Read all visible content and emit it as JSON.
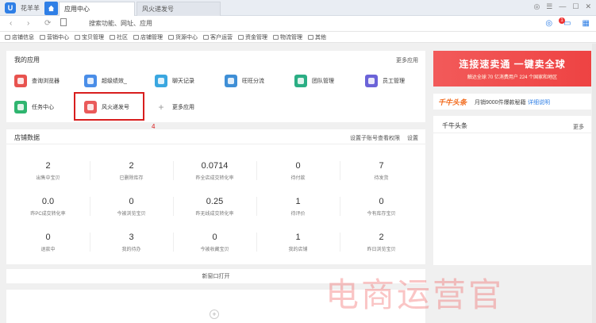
{
  "titlebar": {
    "app_name": "花羊羊",
    "logo_glyph": "U",
    "tabs": [
      {
        "label": "应用中心",
        "active": true
      },
      {
        "label": "风火递发号",
        "active": false
      }
    ],
    "controls": [
      "◎",
      "☰",
      "—",
      "☐",
      "✕"
    ]
  },
  "nav": {
    "back": "‹",
    "forward": "›",
    "refresh": "⟳",
    "address": "搜索功能、网址、应用",
    "badge_count": "1"
  },
  "bookmarks": [
    "店铺信息",
    "营销中心",
    "宝贝管理",
    "社区",
    "店铺管理",
    "货源中心",
    "客户运营",
    "资金管理",
    "物流管理",
    "其他"
  ],
  "my_apps": {
    "title": "我的应用",
    "more_link": "更多应用",
    "apps": [
      {
        "label": "查询浏览器",
        "color": "#e8534f"
      },
      {
        "label": "超级绩效_",
        "color": "#4a8ee8"
      },
      {
        "label": "聊天记录",
        "color": "#3aa7e0"
      },
      {
        "label": "旺旺分流",
        "color": "#3f8fd6"
      },
      {
        "label": "团队管理",
        "color": "#2bae84"
      },
      {
        "label": "员工管理",
        "color": "#6b63d8"
      },
      {
        "label": "任务中心",
        "color": "#2fb56f"
      },
      {
        "label": "风火递发号",
        "color": "#ea5a5a"
      },
      {
        "label": "更多应用",
        "color": "#ffffff"
      }
    ],
    "annotation": "4"
  },
  "shop_data": {
    "title": "店铺数据",
    "links": [
      "设置子账号查看权限",
      "设置"
    ],
    "stats": [
      {
        "value": "2",
        "label": "出售中宝贝"
      },
      {
        "value": "2",
        "label": "已删除库存"
      },
      {
        "value": "0.0714",
        "label": "昨全店成交转化率"
      },
      {
        "value": "0",
        "label": "待付款"
      },
      {
        "value": "7",
        "label": "待发货"
      },
      {
        "value": "0.0",
        "label": "昨PC成交转化率"
      },
      {
        "value": "0",
        "label": "今被浏览宝贝"
      },
      {
        "value": "0.25",
        "label": "昨无线成交转化率"
      },
      {
        "value": "1",
        "label": "待评价"
      },
      {
        "value": "0",
        "label": "今有库存宝贝"
      },
      {
        "value": "0",
        "label": "退款中"
      },
      {
        "value": "3",
        "label": "我的待办"
      },
      {
        "value": "0",
        "label": "今被收藏宝贝"
      },
      {
        "value": "1",
        "label": "我的店铺"
      },
      {
        "value": "2",
        "label": "昨日浏览宝贝"
      }
    ]
  },
  "new_window": {
    "label": "新窗口打开",
    "add": "+"
  },
  "banner": {
    "headline": "连接速卖通 一键卖全球",
    "sub": "触达全球 70 亿消费用户 224 个国家和地区"
  },
  "headline_bar": {
    "brand": "千牛头条",
    "text": "月销9000件爆款秘籍",
    "link": "详细说明"
  },
  "news": {
    "title": "千牛头条",
    "more": "更多"
  },
  "watermark": "电商运营官",
  "colors": {
    "accent": "#2f7fe6",
    "highlight": "#d81e1e",
    "banner": "#ee4343"
  }
}
